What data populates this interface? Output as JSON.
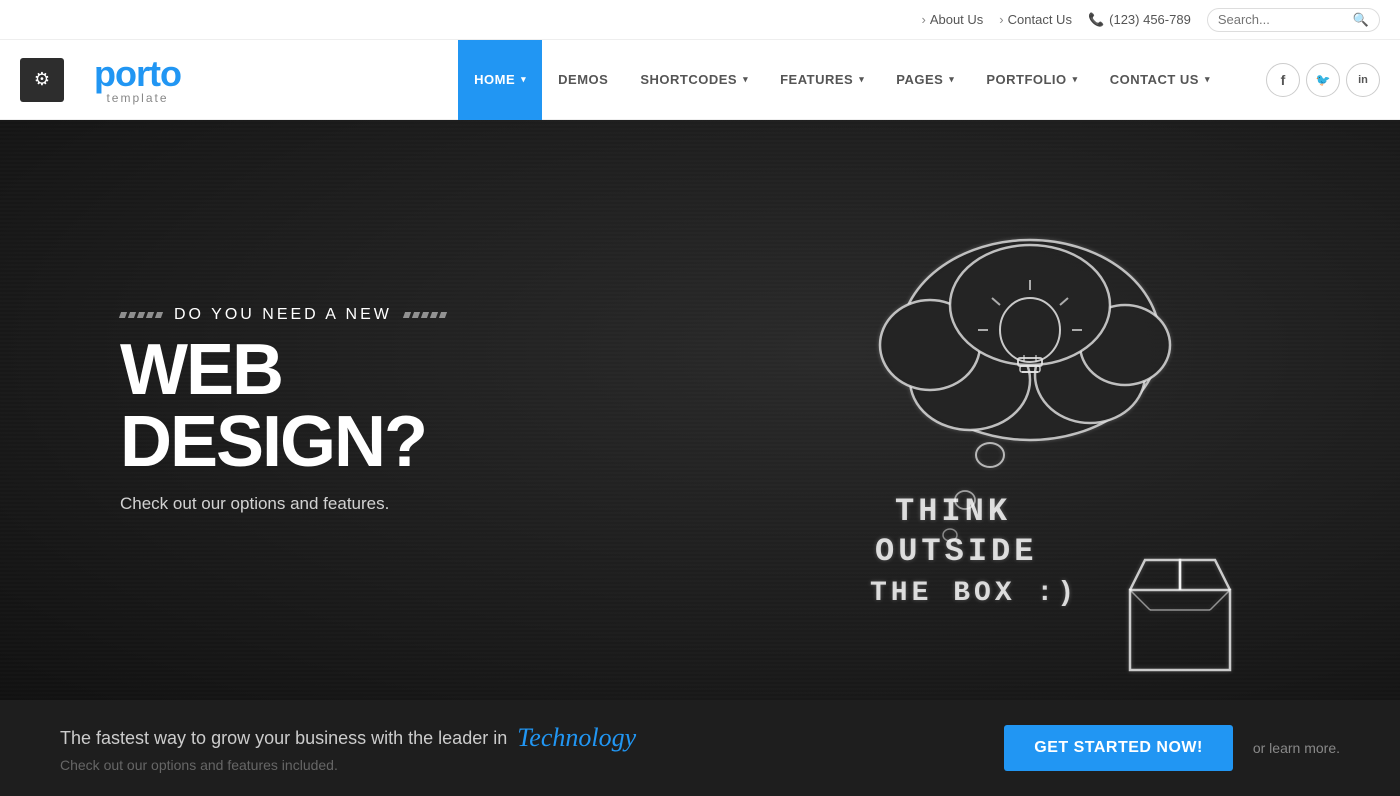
{
  "topbar": {
    "about_us": "About Us",
    "contact_us": "Contact Us",
    "phone": "(123) 456-789",
    "search_placeholder": "Search..."
  },
  "header": {
    "logo_text": "porto",
    "logo_sub": "template",
    "nav": [
      {
        "label": "HOME",
        "active": true,
        "has_arrow": true
      },
      {
        "label": "DEMOS",
        "active": false,
        "has_arrow": false
      },
      {
        "label": "SHORTCODES",
        "active": false,
        "has_arrow": true
      },
      {
        "label": "FEATURES",
        "active": false,
        "has_arrow": true
      },
      {
        "label": "PAGES",
        "active": false,
        "has_arrow": true
      },
      {
        "label": "PORTFOLIO",
        "active": false,
        "has_arrow": true
      },
      {
        "label": "CONTACT US",
        "active": false,
        "has_arrow": true
      }
    ],
    "social": [
      {
        "name": "facebook",
        "icon": "f"
      },
      {
        "name": "twitter",
        "icon": "t"
      },
      {
        "name": "linkedin",
        "icon": "in"
      }
    ]
  },
  "hero": {
    "small_text": "DO YOU NEED A NEW",
    "title": "WEB DESIGN?",
    "subtitle": "Check out our options and features.",
    "chalk_text_1": "THINK",
    "chalk_text_2": "OUTSIDE",
    "chalk_text_3": "THE BOX :)"
  },
  "bottom": {
    "text": "The fastest way to grow your business with the leader in",
    "highlight": "Technology",
    "subtext": "Check out our options and features included.",
    "cta_button": "Get Started Now!",
    "or_learn": "or learn more."
  },
  "icons": {
    "gear": "⚙",
    "phone": "📞",
    "search": "🔍",
    "arrow_down": "▾"
  }
}
